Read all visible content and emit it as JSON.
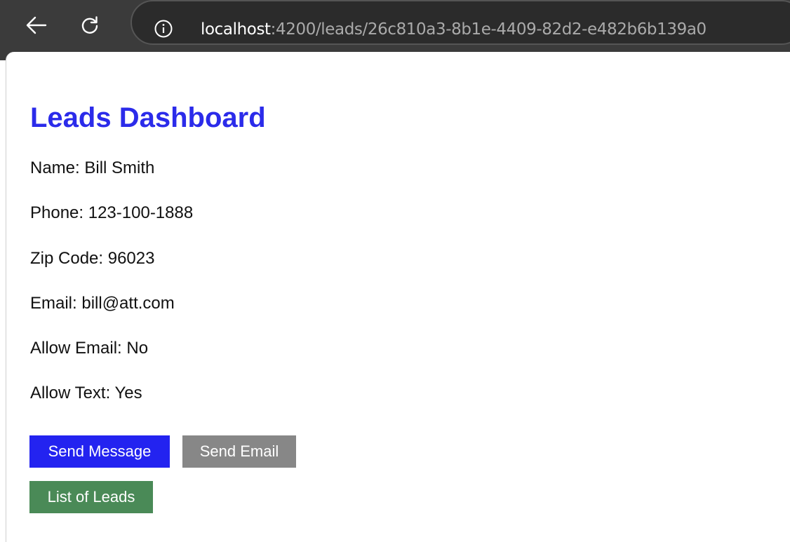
{
  "browser": {
    "url_host": "localhost",
    "url_rest": ":4200/leads/26c810a3-8b1e-4409-82d2-e482b6b139a0",
    "icons": {
      "back": "arrow-left-icon",
      "reload": "reload-icon",
      "site_info": "info-icon"
    }
  },
  "page": {
    "title": "Leads Dashboard"
  },
  "lead": {
    "name": "Name: Bill Smith",
    "phone": "Phone: 123-100-1888",
    "zip": "Zip Code: 96023",
    "email": "Email: bill@att.com",
    "allow_email": "Allow Email: No",
    "allow_text": "Allow Text: Yes"
  },
  "actions": {
    "send_message": "Send Message",
    "send_email": "Send Email",
    "list_of_leads": "List of Leads"
  },
  "colors": {
    "title": "#2b2bea",
    "send_message_bg": "#2323f0",
    "send_email_bg": "#878787",
    "list_of_leads_bg": "#4a8a57",
    "chrome_bg": "#3b3b3b"
  }
}
